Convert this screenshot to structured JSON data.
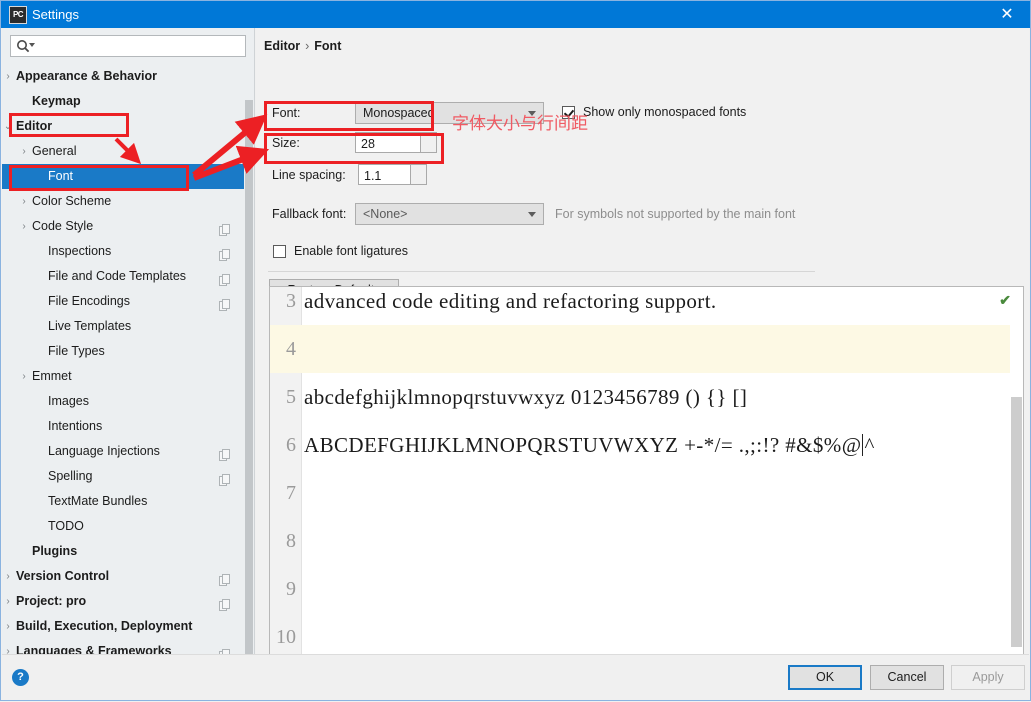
{
  "window": {
    "app_icon_text": "PC",
    "title": "Settings",
    "close_icon": "✕"
  },
  "search": {
    "icon": "search-icon",
    "value": "",
    "placeholder": ""
  },
  "sidebar": {
    "items": [
      {
        "label": "Appearance & Behavior",
        "indent": 0,
        "arrow": "›",
        "bold": true,
        "selected": false,
        "copy": false
      },
      {
        "label": "Keymap",
        "indent": 1,
        "arrow": "",
        "bold": true,
        "selected": false,
        "copy": false
      },
      {
        "label": "Editor",
        "indent": 0,
        "arrow": "⌄",
        "bold": true,
        "selected": false,
        "copy": false
      },
      {
        "label": "General",
        "indent": 1,
        "arrow": "›",
        "bold": false,
        "selected": false,
        "copy": false
      },
      {
        "label": "Font",
        "indent": 2,
        "arrow": "",
        "bold": false,
        "selected": true,
        "copy": false
      },
      {
        "label": "Color Scheme",
        "indent": 1,
        "arrow": "›",
        "bold": false,
        "selected": false,
        "copy": false
      },
      {
        "label": "Code Style",
        "indent": 1,
        "arrow": "›",
        "bold": false,
        "selected": false,
        "copy": true
      },
      {
        "label": "Inspections",
        "indent": 2,
        "arrow": "",
        "bold": false,
        "selected": false,
        "copy": true
      },
      {
        "label": "File and Code Templates",
        "indent": 2,
        "arrow": "",
        "bold": false,
        "selected": false,
        "copy": true
      },
      {
        "label": "File Encodings",
        "indent": 2,
        "arrow": "",
        "bold": false,
        "selected": false,
        "copy": true
      },
      {
        "label": "Live Templates",
        "indent": 2,
        "arrow": "",
        "bold": false,
        "selected": false,
        "copy": false
      },
      {
        "label": "File Types",
        "indent": 2,
        "arrow": "",
        "bold": false,
        "selected": false,
        "copy": false
      },
      {
        "label": "Emmet",
        "indent": 1,
        "arrow": "›",
        "bold": false,
        "selected": false,
        "copy": false
      },
      {
        "label": "Images",
        "indent": 2,
        "arrow": "",
        "bold": false,
        "selected": false,
        "copy": false
      },
      {
        "label": "Intentions",
        "indent": 2,
        "arrow": "",
        "bold": false,
        "selected": false,
        "copy": false
      },
      {
        "label": "Language Injections",
        "indent": 2,
        "arrow": "",
        "bold": false,
        "selected": false,
        "copy": true
      },
      {
        "label": "Spelling",
        "indent": 2,
        "arrow": "",
        "bold": false,
        "selected": false,
        "copy": true
      },
      {
        "label": "TextMate Bundles",
        "indent": 2,
        "arrow": "",
        "bold": false,
        "selected": false,
        "copy": false
      },
      {
        "label": "TODO",
        "indent": 2,
        "arrow": "",
        "bold": false,
        "selected": false,
        "copy": false
      },
      {
        "label": "Plugins",
        "indent": 1,
        "arrow": "",
        "bold": true,
        "selected": false,
        "copy": false
      },
      {
        "label": "Version Control",
        "indent": 0,
        "arrow": "›",
        "bold": true,
        "selected": false,
        "copy": true
      },
      {
        "label": "Project: pro",
        "indent": 0,
        "arrow": "›",
        "bold": true,
        "selected": false,
        "copy": true
      },
      {
        "label": "Build, Execution, Deployment",
        "indent": 0,
        "arrow": "›",
        "bold": true,
        "selected": false,
        "copy": false
      },
      {
        "label": "Languages & Frameworks",
        "indent": 0,
        "arrow": "›",
        "bold": true,
        "selected": false,
        "copy": true
      }
    ]
  },
  "breadcrumb": {
    "parent": "Editor",
    "separator": "›",
    "current": "Font"
  },
  "settings": {
    "font_label": "Font:",
    "font_value": "Monospaced",
    "show_monospaced_label": "Show only monospaced fonts",
    "show_monospaced_checked": true,
    "size_label": "Size:",
    "size_value": "28",
    "line_spacing_label": "Line spacing:",
    "line_spacing_value": "1.1",
    "fallback_label": "Fallback font:",
    "fallback_value": "<None>",
    "fallback_hint": "For symbols not supported by the main font",
    "ligatures_label": "Enable font ligatures",
    "ligatures_checked": false,
    "restore_defaults_label": "Restore Defaults"
  },
  "preview": {
    "status_icon": "✔",
    "lines": [
      {
        "number": "3",
        "text": "advanced code editing and refactoring support.",
        "highlight": false,
        "caret": false
      },
      {
        "number": "4",
        "text": "",
        "highlight": true,
        "caret": false
      },
      {
        "number": "5",
        "text": "abcdefghijklmnopqrstuvwxyz 0123456789 () {} []",
        "highlight": false,
        "caret": false
      },
      {
        "number": "6",
        "text": "ABCDEFGHIJKLMNOPQRSTUVWXYZ +-*/= .,;:!? #&$%@",
        "highlight": false,
        "caret": true
      },
      {
        "number": "7",
        "text": "",
        "highlight": false,
        "caret": false
      },
      {
        "number": "8",
        "text": "",
        "highlight": false,
        "caret": false
      },
      {
        "number": "9",
        "text": "",
        "highlight": false,
        "caret": false
      },
      {
        "number": "10",
        "text": "",
        "highlight": false,
        "caret": false
      }
    ],
    "caret_trailing": "^"
  },
  "footer": {
    "help_label": "?",
    "ok_label": "OK",
    "cancel_label": "Cancel",
    "apply_label": "Apply",
    "apply_disabled": true
  },
  "annotations": {
    "note_text": "字体大小与行间距",
    "box_color": "#ec2024",
    "text_color": "#f05a63"
  },
  "colors": {
    "titlebar": "#0078d7",
    "selection": "#1a7ac7",
    "accent": "#1a7ac7",
    "highlight_line": "#fdf9e4",
    "check_green": "#4a8a3c"
  }
}
